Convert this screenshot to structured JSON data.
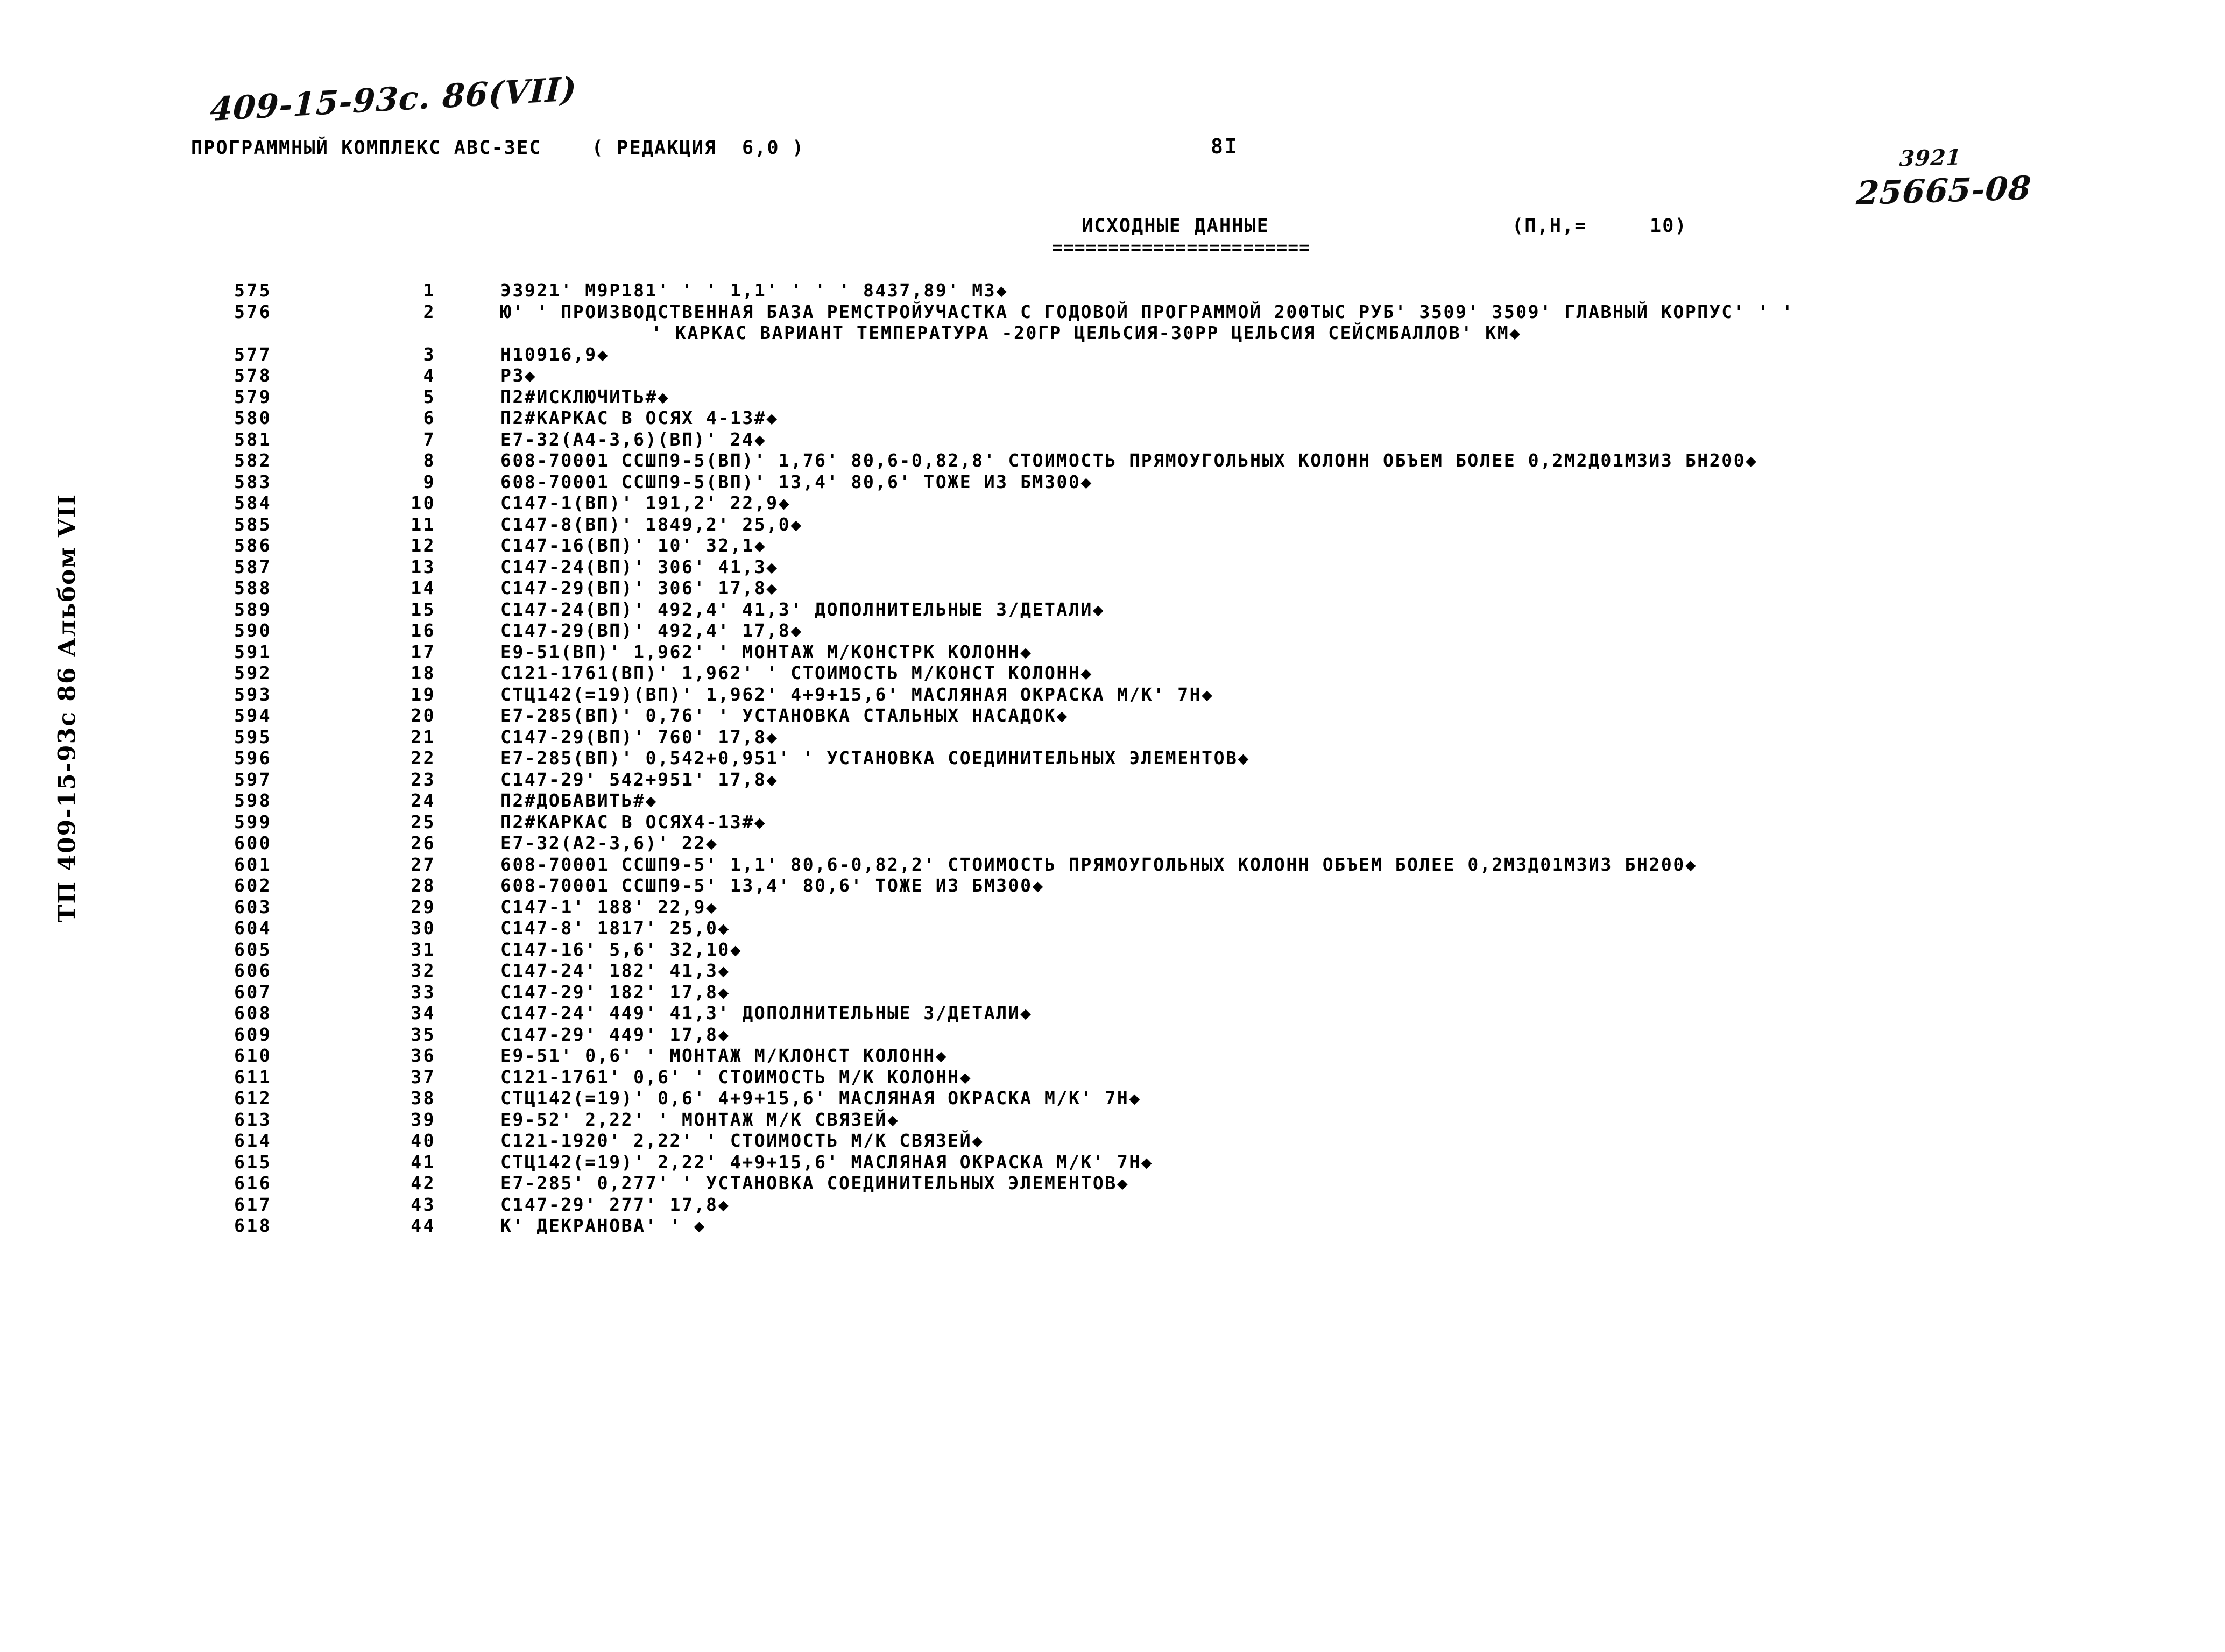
{
  "annotations": {
    "doc_code": "409-15-93с. 86(VII)",
    "order_number": "3921",
    "archive_number": "25665-08"
  },
  "header": {
    "program_line": "ПРОГРАММНЫЙ КОМПЛЕКС АВС-ЗЕС    ( РЕДАКЦИЯ  6,0 )",
    "page_number": "8I",
    "section_title": "ИСХОДНЫЕ ДАННЫЕ",
    "section_underline": "=======================",
    "section_suffix": "(П,Н,=     10)"
  },
  "left_margin": {
    "vertical_stamp": "ТП 409-15-93с 86 Альбом VII"
  },
  "listing": {
    "rows": [
      {
        "lineno": "575",
        "seq": "1",
        "text": "Э3921' М9Р181' ' ' 1,1' ' ' ' 8437,89' М3◆",
        "cont": false
      },
      {
        "lineno": "576",
        "seq": "2",
        "text": "Ю' ' ПРОИЗВОДСТВЕННАЯ БАЗА РЕМСТРОЙУЧАСТКА С ГОДОВОЙ ПРОГРАММОЙ 200ТЫС РУБ' 3509' 3509' ГЛАВНЫЙ КОРПУС' ' '",
        "cont": false
      },
      {
        "lineno": "",
        "seq": "",
        "text": "' КАРКАС ВАРИАНТ ТЕМПЕРАТУРА -20ГР ЦЕЛЬСИЯ-30РР ЦЕЛЬСИЯ СЕЙСМБАЛЛОВ' КМ◆",
        "cont": true
      },
      {
        "lineno": "577",
        "seq": "3",
        "text": "Н10916,9◆",
        "cont": false
      },
      {
        "lineno": "578",
        "seq": "4",
        "text": "Р3◆",
        "cont": false
      },
      {
        "lineno": "579",
        "seq": "5",
        "text": "П2#ИСКЛЮЧИТЬ#◆",
        "cont": false
      },
      {
        "lineno": "580",
        "seq": "6",
        "text": "П2#КАРКАС В ОСЯХ 4-13#◆",
        "cont": false
      },
      {
        "lineno": "581",
        "seq": "7",
        "text": "Е7-32(А4-3,6)(ВП)' 24◆",
        "cont": false
      },
      {
        "lineno": "582",
        "seq": "8",
        "text": "608-70001 ССШП9-5(ВП)' 1,76' 80,6-0,82,8' СТОИМОСТЬ ПРЯМОУГОЛЬНЫХ КОЛОНН ОБЪЕМ БОЛЕЕ 0,2М2Д01М3И3 БН200◆",
        "cont": false
      },
      {
        "lineno": "583",
        "seq": "9",
        "text": "608-70001 ССШП9-5(ВП)' 13,4' 80,6' ТОЖЕ ИЗ БМ300◆",
        "cont": false
      },
      {
        "lineno": "584",
        "seq": "10",
        "text": "С147-1(ВП)' 191,2' 22,9◆",
        "cont": false
      },
      {
        "lineno": "585",
        "seq": "11",
        "text": "С147-8(ВП)' 1849,2' 25,0◆",
        "cont": false
      },
      {
        "lineno": "586",
        "seq": "12",
        "text": "С147-16(ВП)' 10' 32,1◆",
        "cont": false
      },
      {
        "lineno": "587",
        "seq": "13",
        "text": "С147-24(ВП)' 306' 41,3◆",
        "cont": false
      },
      {
        "lineno": "588",
        "seq": "14",
        "text": "С147-29(ВП)' 306' 17,8◆",
        "cont": false
      },
      {
        "lineno": "589",
        "seq": "15",
        "text": "С147-24(ВП)' 492,4' 41,3' ДОПОЛНИТЕЛЬНЫЕ З/ДЕТАЛИ◆",
        "cont": false
      },
      {
        "lineno": "590",
        "seq": "16",
        "text": "С147-29(ВП)' 492,4' 17,8◆",
        "cont": false
      },
      {
        "lineno": "591",
        "seq": "17",
        "text": "Е9-51(ВП)' 1,962' ' МОНТАЖ М/КОНСТРК КОЛОНН◆",
        "cont": false
      },
      {
        "lineno": "592",
        "seq": "18",
        "text": "С121-1761(ВП)' 1,962' ' СТОИМОСТЬ М/КОНСТ КОЛОНН◆",
        "cont": false
      },
      {
        "lineno": "593",
        "seq": "19",
        "text": "СТЦ142(=19)(ВП)' 1,962' 4+9+15,6' МАСЛЯНАЯ ОКРАСКА М/К' 7Н◆",
        "cont": false
      },
      {
        "lineno": "594",
        "seq": "20",
        "text": "Е7-285(ВП)' 0,76' ' УСТАНОВКА СТАЛЬНЫХ НАСАДОК◆",
        "cont": false
      },
      {
        "lineno": "595",
        "seq": "21",
        "text": "С147-29(ВП)' 760' 17,8◆",
        "cont": false
      },
      {
        "lineno": "596",
        "seq": "22",
        "text": "Е7-285(ВП)' 0,542+0,951' ' УСТАНОВКА СОЕДИНИТЕЛЬНЫХ ЭЛЕМЕНТОВ◆",
        "cont": false
      },
      {
        "lineno": "597",
        "seq": "23",
        "text": "С147-29' 542+951' 17,8◆",
        "cont": false
      },
      {
        "lineno": "598",
        "seq": "24",
        "text": "П2#ДОБАВИТЬ#◆",
        "cont": false
      },
      {
        "lineno": "599",
        "seq": "25",
        "text": "П2#КАРКАС В ОСЯХ4-13#◆",
        "cont": false
      },
      {
        "lineno": "600",
        "seq": "26",
        "text": "Е7-32(А2-3,6)' 22◆",
        "cont": false
      },
      {
        "lineno": "601",
        "seq": "27",
        "text": "608-70001 ССШП9-5' 1,1' 80,6-0,82,2' СТОИМОСТЬ ПРЯМОУГОЛЬНЫХ КОЛОНН ОБЪЕМ БОЛЕЕ 0,2М3Д01М3И3 БН200◆",
        "cont": false
      },
      {
        "lineno": "602",
        "seq": "28",
        "text": "608-70001 ССШП9-5' 13,4' 80,6' ТОЖЕ ИЗ БМ300◆",
        "cont": false
      },
      {
        "lineno": "603",
        "seq": "29",
        "text": "С147-1' 188' 22,9◆",
        "cont": false
      },
      {
        "lineno": "604",
        "seq": "30",
        "text": "С147-8' 1817' 25,0◆",
        "cont": false
      },
      {
        "lineno": "605",
        "seq": "31",
        "text": "С147-16' 5,6' 32,10◆",
        "cont": false
      },
      {
        "lineno": "606",
        "seq": "32",
        "text": "С147-24' 182' 41,3◆",
        "cont": false
      },
      {
        "lineno": "607",
        "seq": "33",
        "text": "С147-29' 182' 17,8◆",
        "cont": false
      },
      {
        "lineno": "608",
        "seq": "34",
        "text": "С147-24' 449' 41,3' ДОПОЛНИТЕЛЬНЫЕ З/ДЕТАЛИ◆",
        "cont": false
      },
      {
        "lineno": "609",
        "seq": "35",
        "text": "С147-29' 449' 17,8◆",
        "cont": false
      },
      {
        "lineno": "610",
        "seq": "36",
        "text": "Е9-51' 0,6' ' МОНТАЖ М/КЛОНСТ КОЛОНН◆",
        "cont": false
      },
      {
        "lineno": "611",
        "seq": "37",
        "text": "С121-1761' 0,6' ' СТОИМОСТЬ М/К КОЛОНН◆",
        "cont": false
      },
      {
        "lineno": "612",
        "seq": "38",
        "text": "СТЦ142(=19)' 0,6' 4+9+15,6' МАСЛЯНАЯ ОКРАСКА М/К' 7Н◆",
        "cont": false
      },
      {
        "lineno": "613",
        "seq": "39",
        "text": "Е9-52' 2,22' ' МОНТАЖ М/К СВЯЗЕЙ◆",
        "cont": false
      },
      {
        "lineno": "614",
        "seq": "40",
        "text": "С121-1920' 2,22' ' СТОИМОСТЬ М/К СВЯЗЕЙ◆",
        "cont": false
      },
      {
        "lineno": "615",
        "seq": "41",
        "text": "СТЦ142(=19)' 2,22' 4+9+15,6' МАСЛЯНАЯ ОКРАСКА М/К' 7Н◆",
        "cont": false
      },
      {
        "lineno": "616",
        "seq": "42",
        "text": "Е7-285' 0,277' ' УСТАНОВКА СОЕДИНИТЕЛЬНЫХ ЭЛЕМЕНТОВ◆",
        "cont": false
      },
      {
        "lineno": "617",
        "seq": "43",
        "text": "С147-29' 277' 17,8◆",
        "cont": false
      },
      {
        "lineno": "618",
        "seq": "44",
        "text": "К' ДЕКРАНОВА' ' ◆",
        "cont": false
      }
    ]
  }
}
